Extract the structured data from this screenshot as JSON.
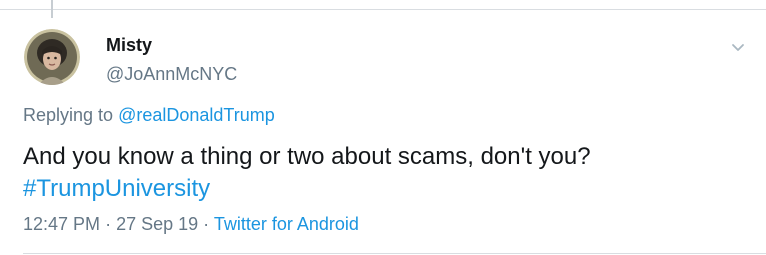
{
  "tweet": {
    "display_name": "Misty",
    "handle": "@JoAnnMcNYC",
    "replying_prefix": "Replying to",
    "replying_to": "@realDonaldTrump",
    "text": "And you know a thing or two about scams, don't you?",
    "hashtag": "#TrumpUniversity",
    "time": "12:47 PM",
    "separator": "·",
    "date": "27 Sep 19",
    "source": "Twitter for Android"
  },
  "icons": {
    "avatar": "avatar-photo",
    "menu": "chevron-down-icon"
  },
  "colors": {
    "link": "#1b95e0",
    "secondary_text": "#657786",
    "primary_text": "#14171a",
    "divider": "#d9dde1"
  }
}
